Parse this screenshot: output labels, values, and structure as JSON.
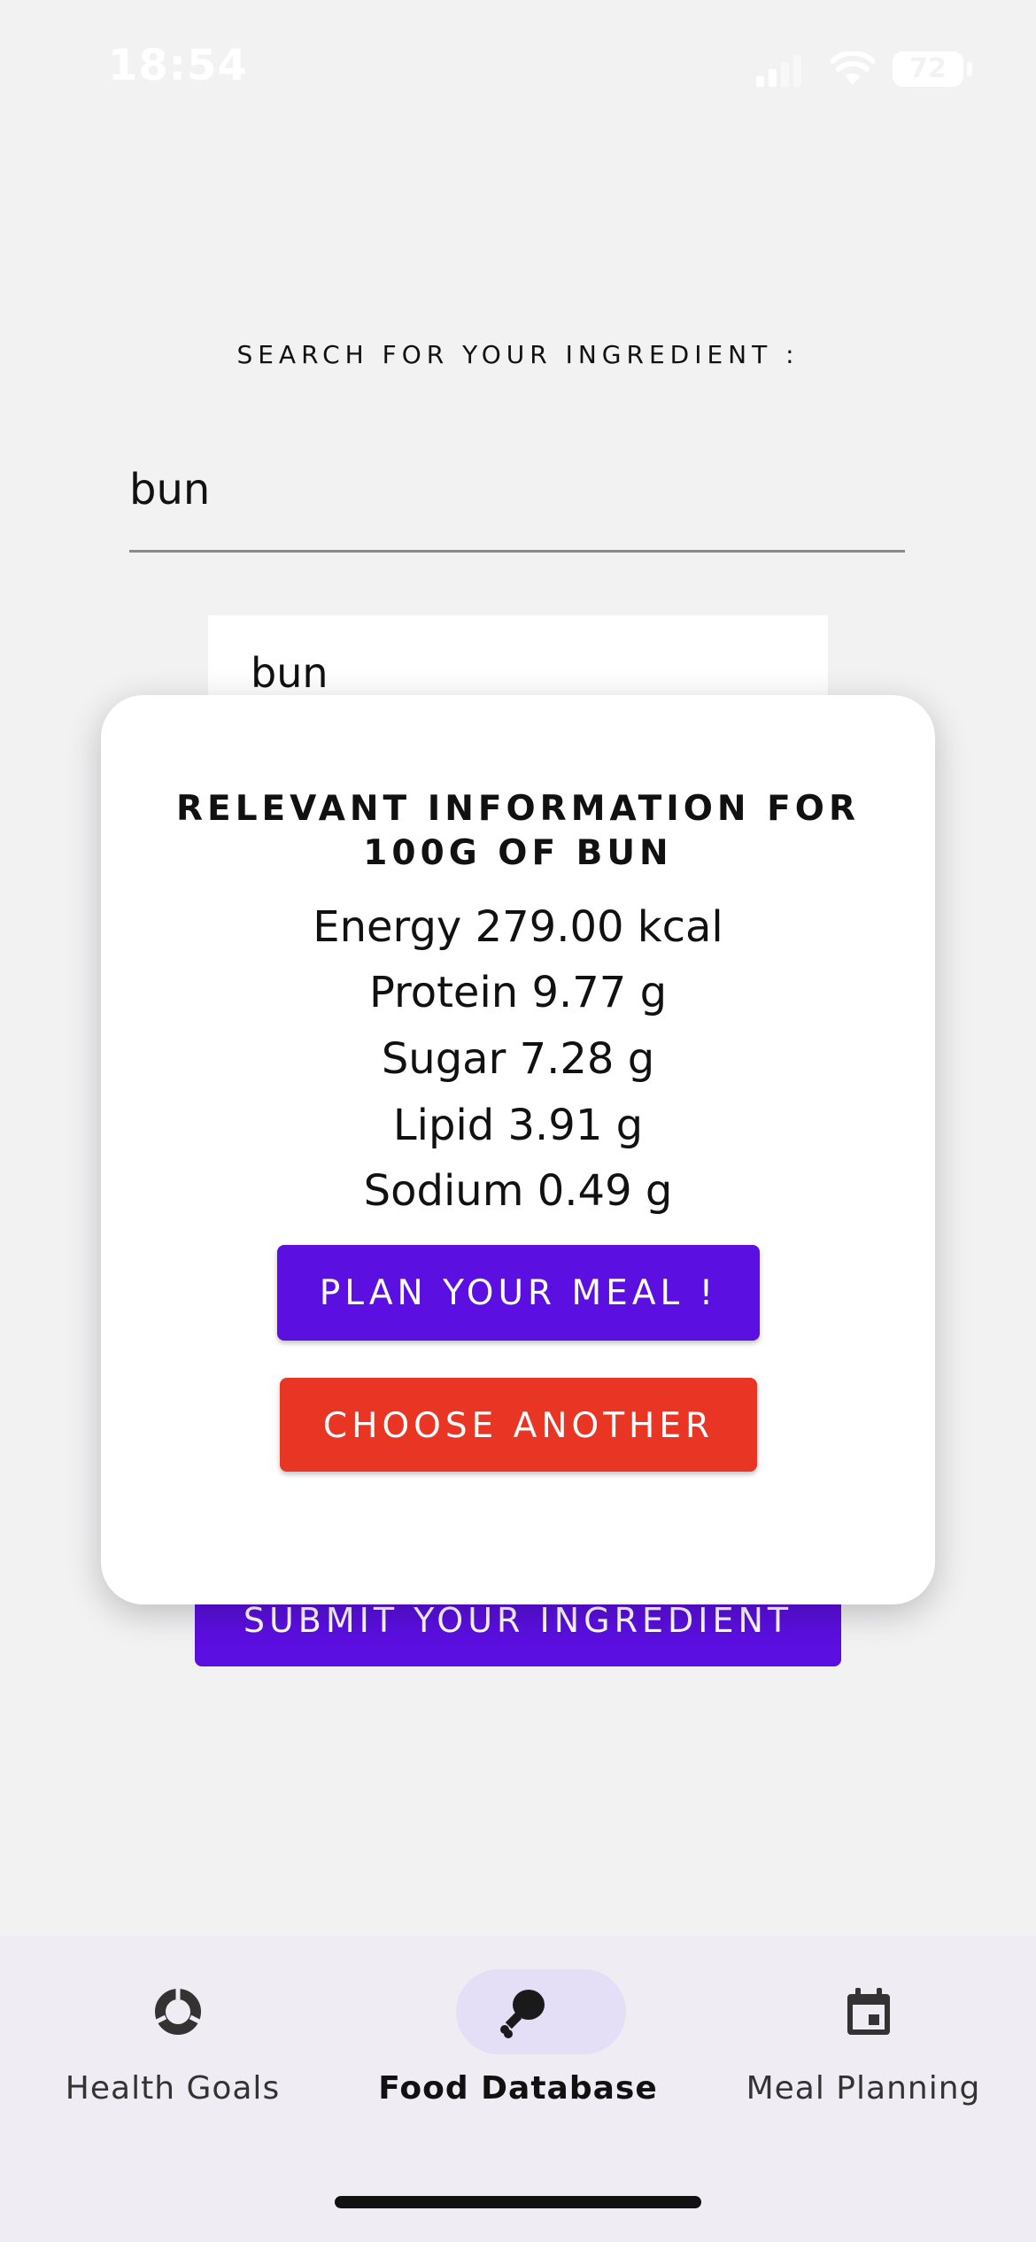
{
  "status_bar": {
    "time": "18:54",
    "battery": "72"
  },
  "search": {
    "heading": "SEARCH FOR YOUR INGREDIENT :",
    "input_value": "bun",
    "suggestion": "bun",
    "submit_label": "SUBMIT YOUR INGREDIENT"
  },
  "dialog": {
    "title": "RELEVANT INFORMATION FOR 100G OF BUN",
    "nutrients": [
      {
        "text": "Energy 279.00 kcal"
      },
      {
        "text": "Protein 9.77 g"
      },
      {
        "text": "Sugar 7.28 g"
      },
      {
        "text": "Lipid 3.91 g"
      },
      {
        "text": "Sodium 0.49 g"
      }
    ],
    "plan_label": "PLAN YOUR MEAL !",
    "choose_label": "CHOOSE ANOTHER"
  },
  "nav": {
    "items": [
      {
        "label": "Health Goals",
        "icon": "donut-chart-icon",
        "active": false
      },
      {
        "label": "Food Database",
        "icon": "drumstick-icon",
        "active": true
      },
      {
        "label": "Meal Planning",
        "icon": "calendar-icon",
        "active": false
      }
    ]
  },
  "colors": {
    "primary": "#5b0fe0",
    "danger": "#e83524",
    "nav_bg": "#f0ecf4",
    "nav_active": "#e5def7"
  }
}
